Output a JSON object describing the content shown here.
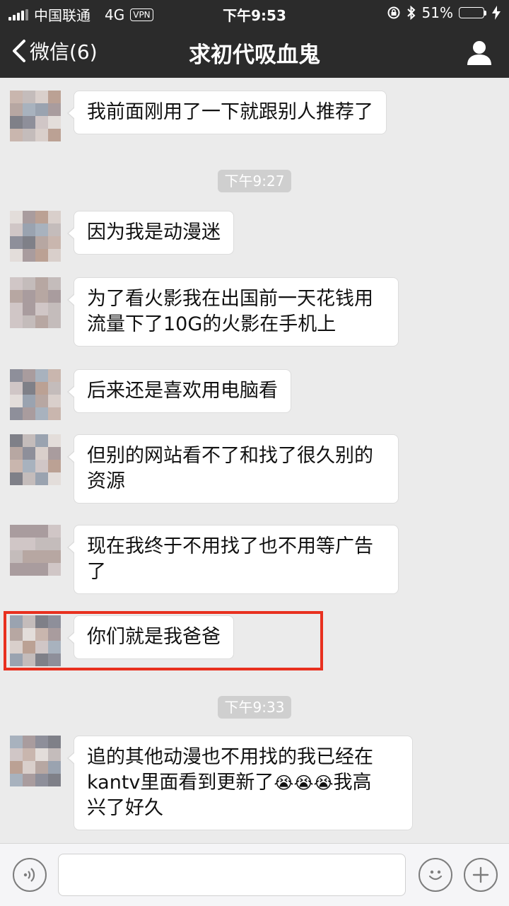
{
  "status_bar": {
    "carrier": "中国联通",
    "network": "4G",
    "vpn": "VPN",
    "time": "下午9:53",
    "battery_percent": "51%",
    "battery_level": 0.51
  },
  "nav": {
    "back_label": "微信(6)",
    "title": "求初代吸血鬼"
  },
  "messages": [
    {
      "text": "我前面刚用了一下就跟别人推荐了"
    },
    {
      "timestamp": "下午9:27"
    },
    {
      "text": "因为我是动漫迷"
    },
    {
      "line1": "为了看火影我在出国前一天花钱用",
      "line2": "流量下了10G的火影在手机上"
    },
    {
      "text": "后来还是喜欢用电脑看"
    },
    {
      "line1": "但别的网站看不了和找了很久别的",
      "line2": "资源"
    },
    {
      "line1": "现在我终于不用找了也不用等广告",
      "line2": "了"
    },
    {
      "text": "你们就是我爸爸"
    },
    {
      "timestamp": "下午9:33"
    },
    {
      "line1": "追的其他动漫也不用找的我已经在",
      "line2a": "kantv里面看到更新了",
      "emoji": "😭",
      "line2b": "我高",
      "line3": "兴了好久"
    }
  ],
  "colors": {
    "nav_bg": "#2b2b2b",
    "chat_bg": "#ebebeb",
    "bubble_bg": "#ffffff",
    "highlight": "#e8301f",
    "battery_fill": "#4cd964"
  },
  "icons": {
    "back": "chevron-left-icon",
    "profile": "person-icon",
    "voice": "voice-icon",
    "emoji": "smiley-icon",
    "more": "plus-icon"
  }
}
